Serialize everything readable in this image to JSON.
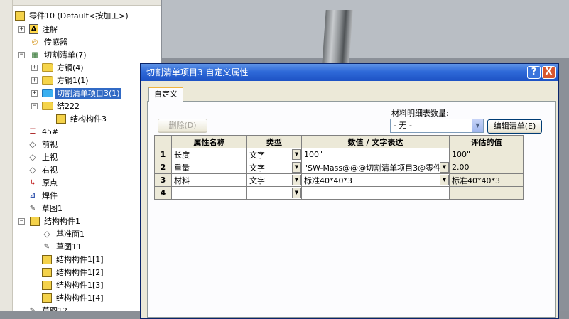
{
  "tree": {
    "root": "零件10  (Default<按加工>)",
    "items": [
      {
        "label": "注解",
        "icon": "annotations-icon"
      },
      {
        "label": "传感器",
        "icon": "sensor-icon"
      },
      {
        "label": "切割清单(7)",
        "icon": "cut-list-icon"
      },
      {
        "label": "方钢(4)",
        "icon": "folder-icon"
      },
      {
        "label": "方钢1(1)",
        "icon": "folder-icon"
      },
      {
        "label": "切割清单项目3(1)",
        "icon": "folder-icon"
      },
      {
        "label": "结222",
        "icon": "folder-icon"
      },
      {
        "label": "结构构件3",
        "icon": "weldment-icon"
      },
      {
        "label": "45#",
        "icon": "material-icon"
      },
      {
        "label": "前视",
        "icon": "plane-icon"
      },
      {
        "label": "上视",
        "icon": "plane-icon"
      },
      {
        "label": "右视",
        "icon": "plane-icon"
      },
      {
        "label": "原点",
        "icon": "origin-icon"
      },
      {
        "label": "焊件",
        "icon": "weldment-icon"
      },
      {
        "label": "草图1",
        "icon": "sketch-icon"
      },
      {
        "label": "结构构件1",
        "icon": "structural-member-icon"
      },
      {
        "label": "基准面1",
        "icon": "plane-icon"
      },
      {
        "label": "草图11",
        "icon": "sketch-icon"
      },
      {
        "label": "结构构件1[1]",
        "icon": "body-icon"
      },
      {
        "label": "结构构件1[2]",
        "icon": "body-icon"
      },
      {
        "label": "结构构件1[3]",
        "icon": "body-icon"
      },
      {
        "label": "结构构件1[4]",
        "icon": "body-icon"
      },
      {
        "label": "草图12",
        "icon": "sketch-icon"
      }
    ]
  },
  "dialog": {
    "title": "切割清单项目3 自定义属性",
    "help": "?",
    "close": "X",
    "tab": "自定义",
    "delete_button": "删除(D)",
    "qty_label": "材料明细表数量:",
    "qty_value": "- 无 -",
    "edit_list_button": "编辑清单(E)",
    "columns": [
      "属性名称",
      "类型",
      "数值 / 文字表达",
      "评估的值"
    ],
    "rows": [
      {
        "num": "1",
        "name": "长度",
        "type": "文字",
        "value": "100\"",
        "evaluated": "100\""
      },
      {
        "num": "2",
        "name": "重量",
        "type": "文字",
        "value": "\"SW-Mass@@@切割清单项目3@零件",
        "evaluated": "2.00"
      },
      {
        "num": "3",
        "name": "材料",
        "type": "文字",
        "value": "标准40*40*3",
        "evaluated": "标准40*40*3"
      },
      {
        "num": "4",
        "name": "",
        "type": "",
        "value": "",
        "evaluated": ""
      }
    ]
  },
  "colors": {
    "title_bar": "#2f6ad9",
    "selection": "#316ac5",
    "dialog_bg": "#ece9d8"
  }
}
